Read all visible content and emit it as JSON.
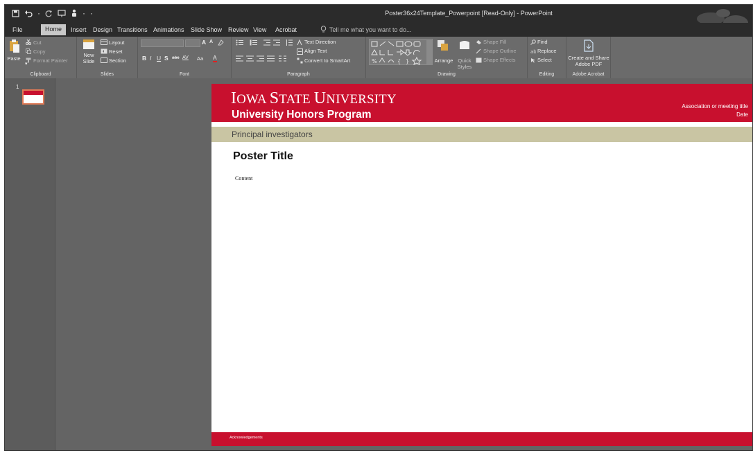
{
  "window": {
    "title": "Poster36x24Template_Powerpoint [Read-Only] - PowerPoint"
  },
  "quick_access": {
    "items": [
      "save-icon",
      "undo-icon",
      "redo-icon",
      "present-icon",
      "touch-mode-icon",
      "customize-icon"
    ]
  },
  "tabs": [
    {
      "label": "File",
      "active": false
    },
    {
      "label": "Home",
      "active": true
    },
    {
      "label": "Insert",
      "active": false
    },
    {
      "label": "Design",
      "active": false
    },
    {
      "label": "Transitions",
      "active": false
    },
    {
      "label": "Animations",
      "active": false
    },
    {
      "label": "Slide Show",
      "active": false
    },
    {
      "label": "Review",
      "active": false
    },
    {
      "label": "View",
      "active": false
    },
    {
      "label": "Acrobat",
      "active": false
    }
  ],
  "tell_me": "Tell me what you want to do...",
  "ribbon": {
    "clipboard": {
      "label": "Clipboard",
      "paste": "Paste",
      "cut": "Cut",
      "copy": "Copy",
      "format_painter": "Format Painter"
    },
    "slides": {
      "label": "Slides",
      "new_slide_1": "New",
      "new_slide_2": "Slide",
      "layout": "Layout",
      "reset": "Reset",
      "section": "Section"
    },
    "font": {
      "label": "Font",
      "bold": "B",
      "italic": "I",
      "underline": "U",
      "strike": "S",
      "abc": "abc",
      "spacing": "AV",
      "case": "Aa",
      "color": "A",
      "grow": "A",
      "shrink": "A"
    },
    "paragraph": {
      "label": "Paragraph",
      "text_direction": "Text Direction",
      "align_text": "Align Text",
      "convert_smartart": "Convert to SmartArt"
    },
    "drawing": {
      "label": "Drawing",
      "arrange": "Arrange",
      "quick_styles_1": "Quick",
      "quick_styles_2": "Styles",
      "shape_fill": "Shape Fill",
      "shape_outline": "Shape Outline",
      "shape_effects": "Shape Effects"
    },
    "editing": {
      "label": "Editing",
      "find": "Find",
      "replace": "Replace",
      "select": "Select"
    },
    "acrobat": {
      "label": "Adobe Acrobat",
      "create_share_1": "Create and Share",
      "create_share_2": "Adobe PDF"
    }
  },
  "thumbnails": [
    {
      "number": "1"
    }
  ],
  "slide": {
    "university": "Iowa State University",
    "program": "University Honors Program",
    "association": "Association or meeting title",
    "date": "Date",
    "investigators": "Principal investigators",
    "poster_title": "Poster Title",
    "content": "Content",
    "acknowledgements": "Acknowledgements"
  },
  "colors": {
    "isu_red": "#c8102e",
    "pi_band": "#c9c5a3",
    "ribbon": "#6b6b6b",
    "workspace": "#646464"
  }
}
